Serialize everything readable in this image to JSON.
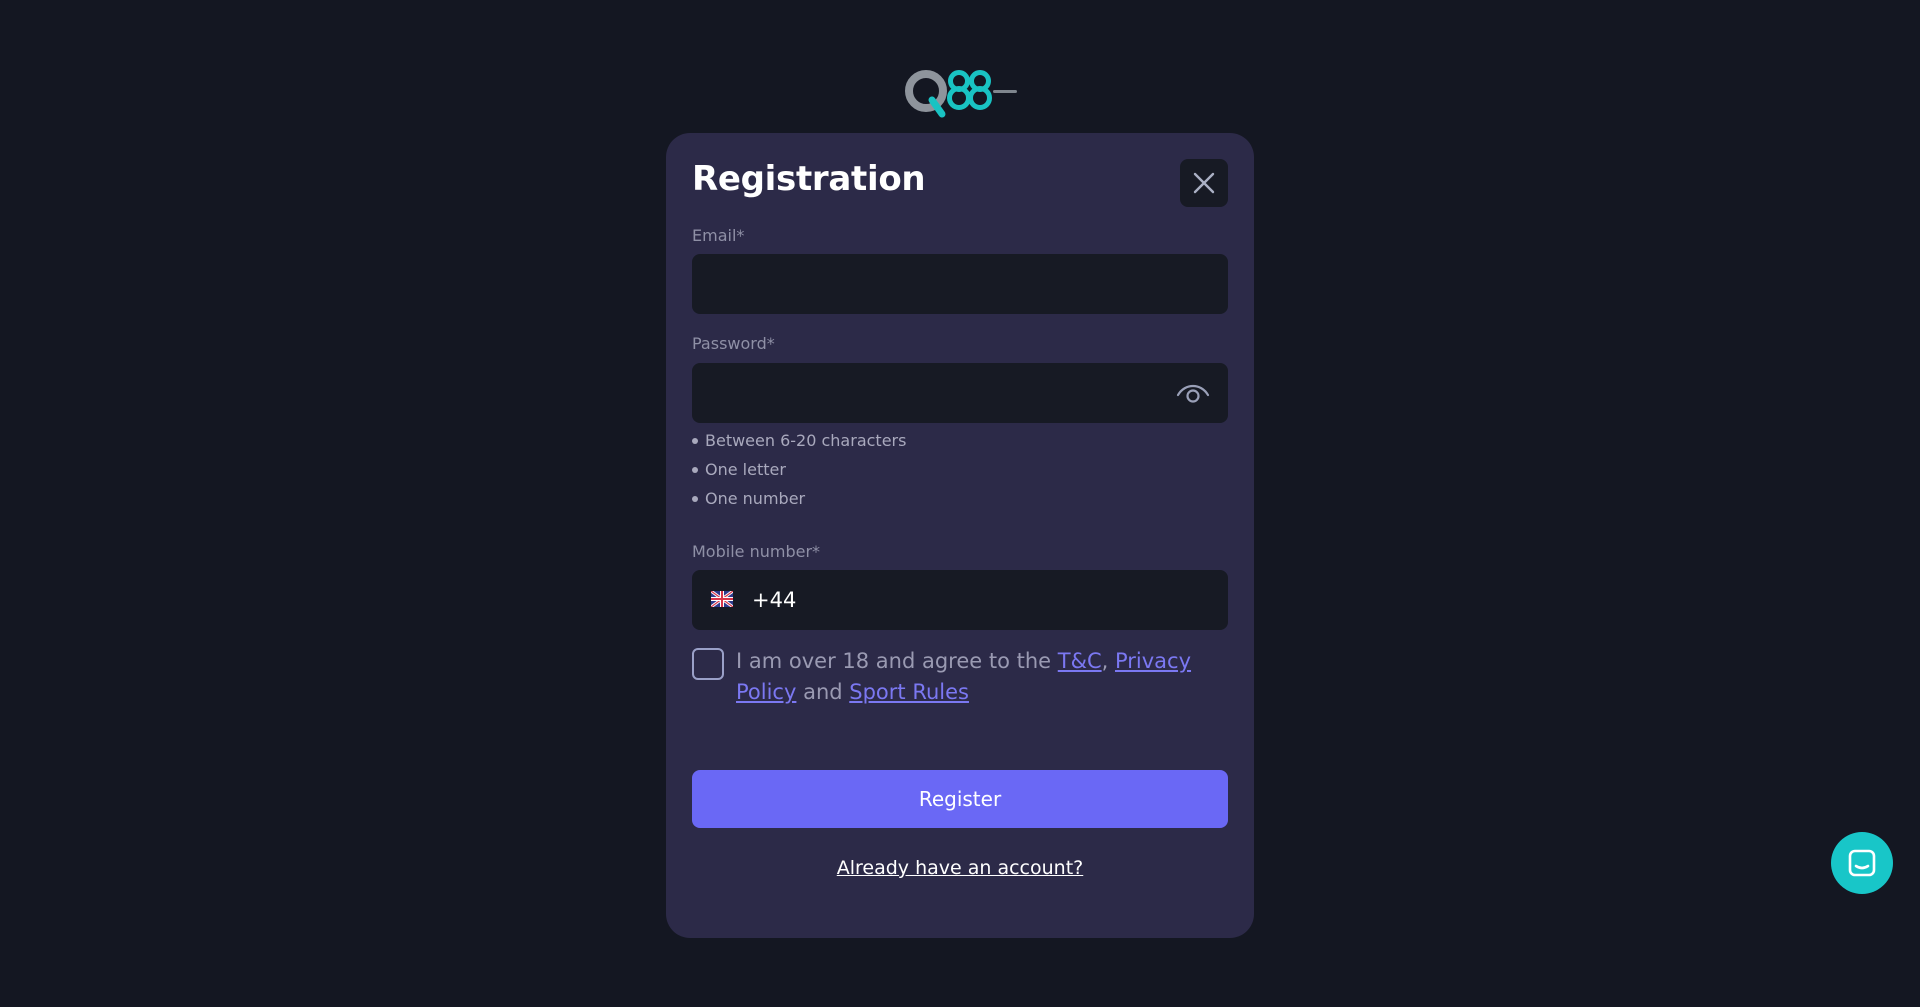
{
  "logo": {
    "icon": "q88-logo-icon"
  },
  "modal": {
    "title": "Registration",
    "close_icon": "close-icon"
  },
  "email": {
    "label": "Email*",
    "value": "",
    "placeholder": ""
  },
  "password": {
    "label": "Password*",
    "value": "",
    "placeholder": "",
    "toggle_icon": "eye-icon",
    "rules": [
      "Between 6-20 characters",
      "One letter",
      "One number"
    ]
  },
  "mobile": {
    "label": "Mobile number*",
    "country_icon": "uk-flag-icon",
    "dial_code": "+44",
    "value": ""
  },
  "agreement": {
    "prefix": "I am over 18 and agree to the ",
    "tc_link": "T&C",
    "comma": ", ",
    "privacy_link": "Privacy Policy",
    "and": " and ",
    "sport_rules_link": "Sport Rules",
    "checked": false
  },
  "register_button": {
    "label": "Register"
  },
  "login_link": {
    "label": "Already have an account?"
  },
  "chat": {
    "icon": "chat-icon"
  },
  "colors": {
    "background": "#141722",
    "modal": "#2c2a48",
    "input": "#171a24",
    "accent": "#6a68f5",
    "link": "#7b78f2",
    "chat": "#18c6c8"
  }
}
